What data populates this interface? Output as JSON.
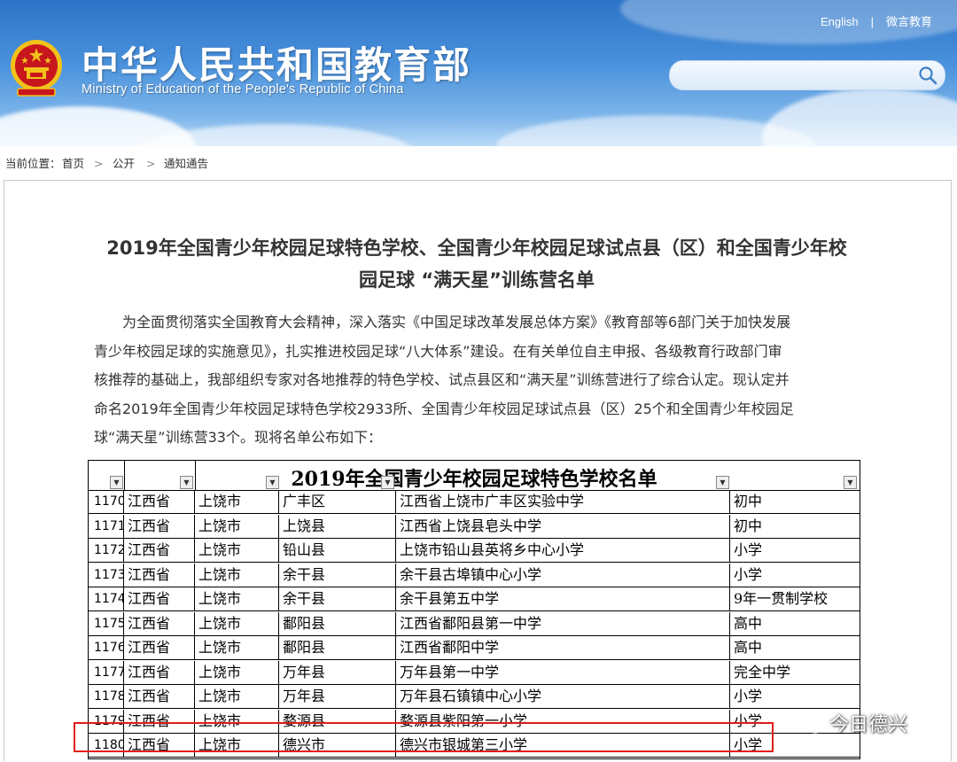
{
  "header": {
    "site_title": "中华人民共和国教育部",
    "site_subtitle": "Ministry of Education of the People's Republic of China",
    "link_english": "English",
    "link_weiyan": "微言教育",
    "separator": "|"
  },
  "breadcrumb": {
    "label": "当前位置：",
    "items": [
      "首页",
      "公开",
      "通知通告"
    ],
    "chevron": ">"
  },
  "article": {
    "title_line1": "2019年全国青少年校园足球特色学校、全国青少年校园足球试点县（区）和全国青少年校",
    "title_line2": "园足球 “满天星”训练营名单",
    "paragraph_lines": [
      "为全面贯彻落实全国教育大会精神，深入落实《中国足球改革发展总体方案》《教育部等6部门关于加快发展",
      "青少年校园足球的实施意见》，扎实推进校园足球“八大体系”建设。在有关单位自主申报、各级教育行政部门审",
      "核推荐的基础上，我部组织专家对各地推荐的特色学校、试点县区和“满天星”训练营进行了综合认定。现认定并",
      "命名2019年全国青少年校园足球特色学校2933所、全国青少年校园足球试点县（区）25个和全国青少年校园足",
      "球“满天星”训练营33个。现将名单公布如下："
    ]
  },
  "sheet": {
    "title": "2019年全国青少年校园足球特色学校名单",
    "dropdown_glyph": "▼",
    "rows": [
      [
        "1170",
        "江西省",
        "上饶市",
        "广丰区",
        "江西省上饶市广丰区实验中学",
        "初中"
      ],
      [
        "1171",
        "江西省",
        "上饶市",
        "上饶县",
        "江西省上饶县皂头中学",
        "初中"
      ],
      [
        "1172",
        "江西省",
        "上饶市",
        "铅山县",
        "上饶市铅山县英将乡中心小学",
        "小学"
      ],
      [
        "1173",
        "江西省",
        "上饶市",
        "余干县",
        "余干县古埠镇中心小学",
        "小学"
      ],
      [
        "1174",
        "江西省",
        "上饶市",
        "余干县",
        "余干县第五中学",
        "9年一贯制学校"
      ],
      [
        "1175",
        "江西省",
        "上饶市",
        "鄱阳县",
        "江西省鄱阳县第一中学",
        "高中"
      ],
      [
        "1176",
        "江西省",
        "上饶市",
        "鄱阳县",
        "江西省鄱阳中学",
        "高中"
      ],
      [
        "1177",
        "江西省",
        "上饶市",
        "万年县",
        "万年县第一中学",
        "完全中学"
      ],
      [
        "1178",
        "江西省",
        "上饶市",
        "万年县",
        "万年县石镇镇中心小学",
        "小学"
      ],
      [
        "1179",
        "江西省",
        "上饶市",
        "婺源县",
        "婺源县紫阳第一小学",
        "小学"
      ],
      [
        "1180",
        "江西省",
        "上饶市",
        "德兴市",
        "德兴市银城第三小学",
        "小学"
      ]
    ]
  },
  "watermark": {
    "text": "今日德兴"
  },
  "colors": {
    "header_blue": "#2d74c7",
    "highlight_red": "#e21b1b",
    "emblem_red": "#c8161d",
    "emblem_gold": "#f2c21b"
  }
}
